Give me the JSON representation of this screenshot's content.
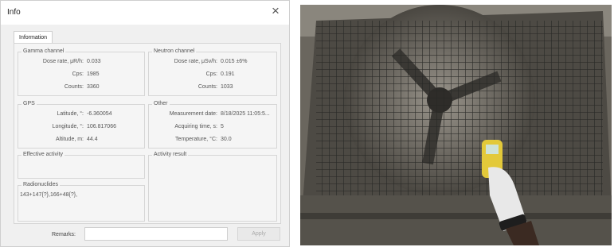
{
  "dialog": {
    "title": "Info",
    "close_glyph": "×",
    "tab_label": "Information",
    "gamma_channel": {
      "title": "Gamma channel",
      "rows": [
        {
          "label": "Dose rate, μR/h:",
          "value": "0.033"
        },
        {
          "label": "Cps:",
          "value": "1985"
        },
        {
          "label": "Counts:",
          "value": "3360"
        }
      ]
    },
    "neutron_channel": {
      "title": "Neutron channel",
      "rows": [
        {
          "label": "Dose rate, μSv/h:",
          "value": "0.015 ±6%"
        },
        {
          "label": "Cps:",
          "value": "0.191"
        },
        {
          "label": "Counts:",
          "value": "1033"
        }
      ]
    },
    "gps": {
      "title": "GPS",
      "rows": [
        {
          "label": "Latitude, °:",
          "value": "-6.360054"
        },
        {
          "label": "Longitude, °:",
          "value": "106.817066"
        },
        {
          "label": "Altitude, m:",
          "value": "44.4"
        }
      ]
    },
    "other": {
      "title": "Other",
      "rows": [
        {
          "label": "Measurement date:",
          "value": "8/18/2025 11:05:5..."
        },
        {
          "label": "Acquiring time, s:",
          "value": "5"
        },
        {
          "label": "Temperature, °C:",
          "value": "30.0"
        }
      ]
    },
    "effective_activity": {
      "title": "Effective activity"
    },
    "activity_result": {
      "title": "Activity result"
    },
    "radionuclides": {
      "title": "Radionuclides",
      "text": "143+147{?},166+48{?},"
    },
    "remarks": {
      "label": "Remarks:",
      "value": "",
      "placeholder": ""
    },
    "apply_label": "Apply"
  },
  "photo": {
    "description_icon": "fan-grille-photo",
    "colors": {
      "wall": "#5a5650",
      "grille": "#3a3a38",
      "glove": "#e8e8e8",
      "device": "#e3c93a"
    }
  }
}
